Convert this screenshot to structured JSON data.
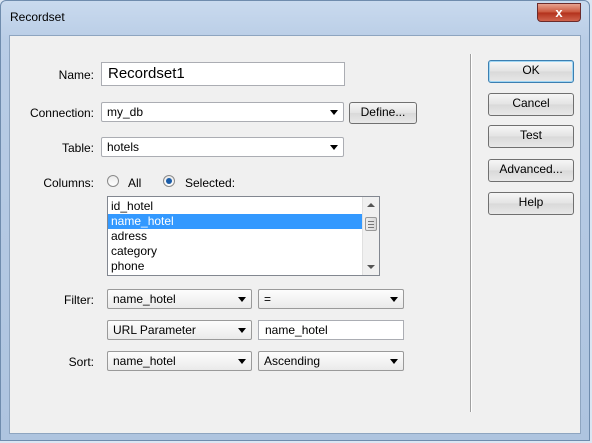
{
  "window": {
    "title": "Recordset",
    "close_label": "x"
  },
  "form": {
    "name_label": "Name:",
    "name_value": "Recordset1",
    "connection_label": "Connection:",
    "connection_value": "my_db",
    "define_label": "Define...",
    "table_label": "Table:",
    "table_value": "hotels",
    "columns_label": "Columns:",
    "columns_all_label": "All",
    "columns_selected_label": "Selected:",
    "columns_mode": "Selected",
    "columns_list": [
      "id_hotel",
      "name_hotel",
      "adress",
      "category",
      "phone"
    ],
    "columns_selected_item": "name_hotel",
    "filter_label": "Filter:",
    "filter_column": "name_hotel",
    "filter_operator": "=",
    "filter_source": "URL Parameter",
    "filter_value": "name_hotel",
    "sort_label": "Sort:",
    "sort_column": "name_hotel",
    "sort_order": "Ascending"
  },
  "buttons": {
    "ok": "OK",
    "cancel": "Cancel",
    "test": "Test",
    "advanced": "Advanced...",
    "help": "Help"
  },
  "colors": {
    "selection": "#3399ff",
    "close_button": "#c9543a",
    "title_bar": "#b9cde6"
  }
}
